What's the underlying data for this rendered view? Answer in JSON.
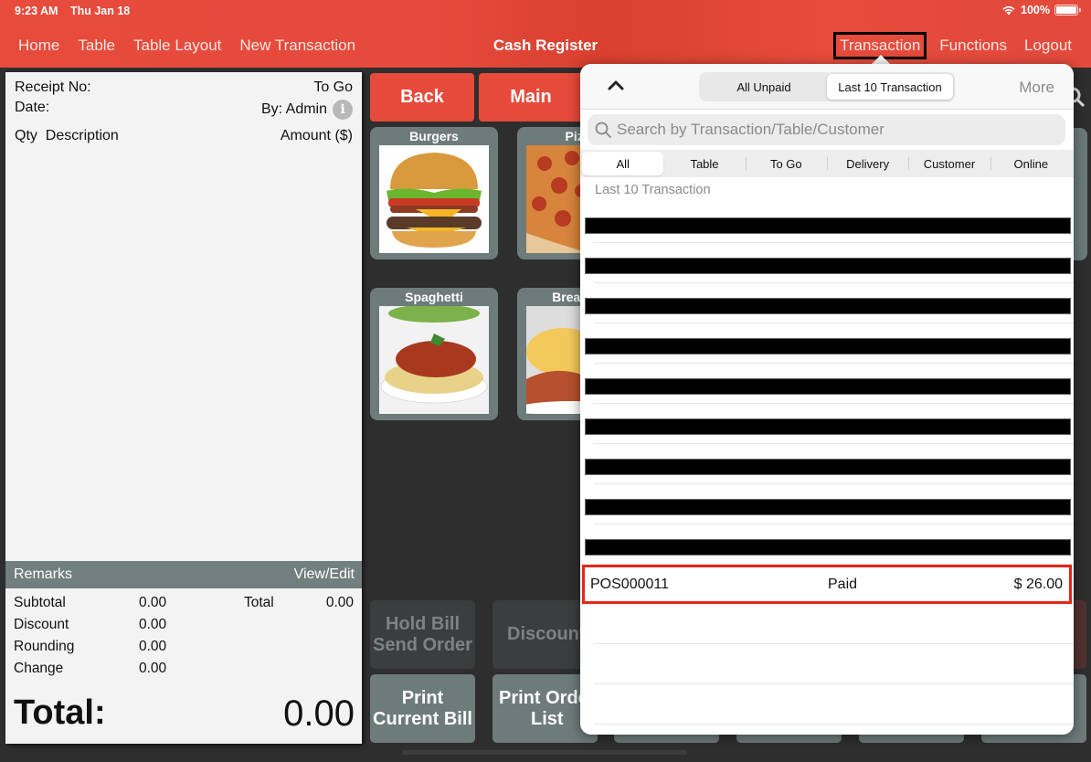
{
  "status_bar": {
    "time": "9:23 AM",
    "date": "Thu Jan 18",
    "battery_text": "100%",
    "battery_level": 1.0
  },
  "nav": {
    "left": [
      "Home",
      "Table",
      "Table Layout",
      "New Transaction"
    ],
    "title": "Cash Register",
    "right": [
      "Transaction",
      "Functions",
      "Logout"
    ],
    "active": "Transaction"
  },
  "receipt": {
    "receipt_no_label": "Receipt No:",
    "order_type": "To Go",
    "date_label": "Date:",
    "by_label": "By: Admin",
    "info_icon": "i",
    "col_qty": "Qty",
    "col_desc": "Description",
    "col_amount": "Amount ($)",
    "remarks_label": "Remarks",
    "remarks_action": "View/Edit",
    "totals": [
      {
        "label": "Subtotal",
        "value": "0.00"
      },
      {
        "label": "Discount",
        "value": "0.00"
      },
      {
        "label": "Rounding",
        "value": "0.00"
      },
      {
        "label": "Change",
        "value": "0.00"
      }
    ],
    "total_small_label": "Total",
    "total_small_value": "0.00",
    "grand_total_label": "Total:",
    "grand_total_value": "0.00"
  },
  "menu": {
    "back_label": "Back",
    "main_label": "Main",
    "categories": [
      {
        "name": "Burgers"
      },
      {
        "name": "Pizza",
        "visible_text": "Piz"
      },
      {
        "name": "Spaghetti"
      },
      {
        "name": "Breakfast",
        "visible_text": "Brea"
      }
    ],
    "actions": {
      "hold_bill": [
        "Hold Bill",
        "Send Order"
      ],
      "discount": "Discount",
      "print_current_bill": [
        "Print",
        "Current Bill"
      ],
      "print_order_list": [
        "Print Order",
        "List"
      ]
    }
  },
  "popover": {
    "segments": [
      "All Unpaid",
      "Last 10 Transaction"
    ],
    "selected_segment": "Last 10 Transaction",
    "more_label": "More",
    "search_placeholder": "Search by Transaction/Table/Customer",
    "filters": [
      "All",
      "Table",
      "To Go",
      "Delivery",
      "Customer",
      "Online"
    ],
    "selected_filter": "All",
    "section_title": "Last 10 Transaction",
    "redacted_rows": 9,
    "highlighted_transaction": {
      "id": "POS000011",
      "status": "Paid",
      "amount": "$ 26.00"
    }
  },
  "colors": {
    "brand_red": "#e64b3c",
    "tile_grey": "#6e7b7b",
    "highlight_red": "#e5261a"
  }
}
